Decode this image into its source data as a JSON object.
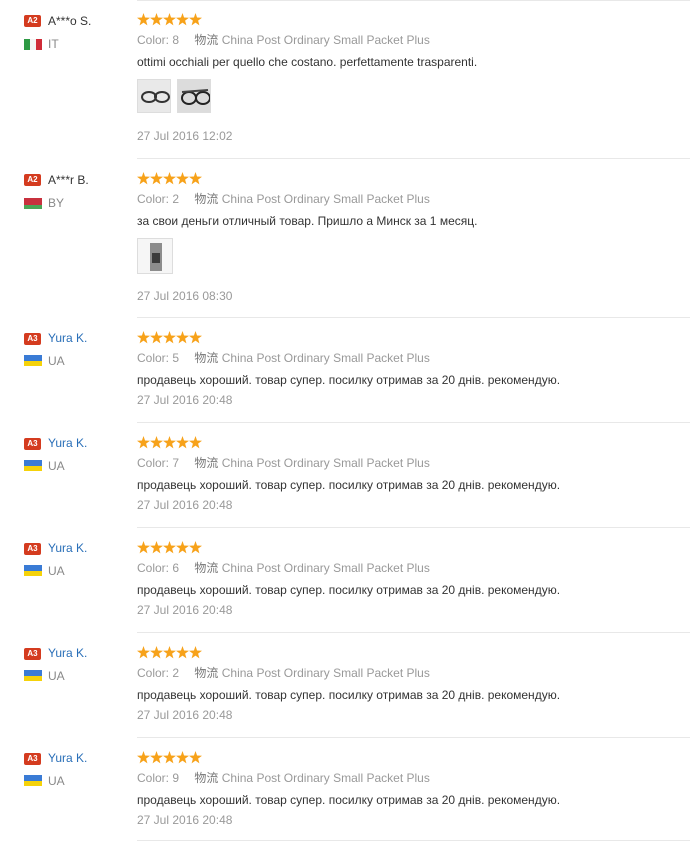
{
  "reviews": [
    {
      "badge": "A2",
      "name": "A***o S.",
      "country": "IT",
      "color_label": "Color:",
      "color_value": "8",
      "logistics_label": "物流",
      "logistics_value": "China Post Ordinary Small Packet Plus",
      "text": "ottimi occhiali per quello che costano. perfettamente trasparenti.",
      "date": "27 Jul 2016 12:02",
      "rating": 5
    },
    {
      "badge": "A2",
      "name": "A***r B.",
      "country": "BY",
      "color_label": "Color:",
      "color_value": "2",
      "logistics_label": "物流",
      "logistics_value": "China Post Ordinary Small Packet Plus",
      "text": "за свои деньги отличный товар. Пришло а Минск за 1 месяц.",
      "date": "27 Jul 2016 08:30",
      "rating": 5
    },
    {
      "badge": "A3",
      "name": "Yura K.",
      "country": "UA",
      "color_label": "Color:",
      "color_value": "5",
      "logistics_label": "物流",
      "logistics_value": "China Post Ordinary Small Packet Plus",
      "text": "продавець хороший. товар супер. посилку отримав за 20 днів. рекомендую.",
      "date": "27 Jul 2016 20:48",
      "rating": 5
    },
    {
      "badge": "A3",
      "name": "Yura K.",
      "country": "UA",
      "color_label": "Color:",
      "color_value": "7",
      "logistics_label": "物流",
      "logistics_value": "China Post Ordinary Small Packet Plus",
      "text": "продавець хороший. товар супер. посилку отримав за 20 днів. рекомендую.",
      "date": "27 Jul 2016 20:48",
      "rating": 5
    },
    {
      "badge": "A3",
      "name": "Yura K.",
      "country": "UA",
      "color_label": "Color:",
      "color_value": "6",
      "logistics_label": "物流",
      "logistics_value": "China Post Ordinary Small Packet Plus",
      "text": "продавець хороший. товар супер. посилку отримав за 20 днів. рекомендую.",
      "date": "27 Jul 2016 20:48",
      "rating": 5
    },
    {
      "badge": "A3",
      "name": "Yura K.",
      "country": "UA",
      "color_label": "Color:",
      "color_value": "2",
      "logistics_label": "物流",
      "logistics_value": "China Post Ordinary Small Packet Plus",
      "text": "продавець хороший. товар супер. посилку отримав за 20 днів. рекомендую.",
      "date": "27 Jul 2016 20:48",
      "rating": 5
    },
    {
      "badge": "A3",
      "name": "Yura K.",
      "country": "UA",
      "color_label": "Color:",
      "color_value": "9",
      "logistics_label": "物流",
      "logistics_value": "China Post Ordinary Small Packet Plus",
      "text": "продавець хороший. товар супер. посилку отримав за 20 днів. рекомендую.",
      "date": "27 Jul 2016 20:48",
      "rating": 5
    }
  ],
  "colors": {
    "badge": "#d43b1f",
    "star": "#f7a21a",
    "link": "#2a6fb8",
    "muted": "#999999",
    "divider": "#e8e8e8"
  }
}
